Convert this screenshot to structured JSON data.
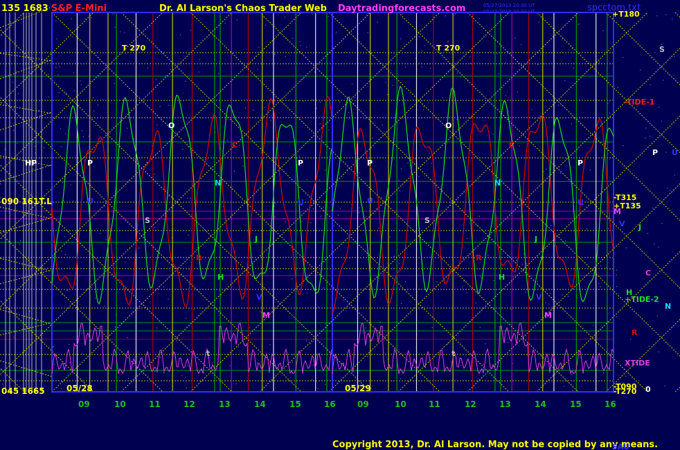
{
  "header": {
    "left_price": "135  1683",
    "symbol": "S&P E-Mini",
    "title": "Dr. Al Larson's Chaos Trader Web",
    "site": "Daytradingforecasts.com",
    "stamp_1": "05/27/2013 20:30 UT",
    "stamp_2": "05/27/2013 20:30 UT",
    "filename": "spcctom.txt",
    "top_level": "+T180"
  },
  "footer": {
    "copyright": "Copyright 2013, Dr. Al Larson. May not be copied by any means.",
    "bottom_right": "SAU"
  },
  "colors": {
    "background": "#000050",
    "grid_yellow": "#d8d800",
    "grid_green": "#00b000",
    "grid_red": "#c00000",
    "grid_magenta": "#c000c0",
    "frame_blue": "#3030ff",
    "trace_red": "#e00000",
    "trace_green": "#20e020",
    "trace_xtide": "#e040e0"
  },
  "left_scale": {
    "top": "135  1683",
    "mid": "090  161T.L",
    "bottom": "045  1665"
  },
  "chart_data": {
    "type": "line",
    "title": "S&P E-Mini",
    "x_dates_panel_1": "05/28",
    "x_dates_panel_2": "05/29",
    "x_tick_labels": [
      "09",
      "10",
      "11",
      "12",
      "13",
      "14",
      "15",
      "16",
      "09",
      "10",
      "11",
      "12",
      "13",
      "14",
      "15",
      "16"
    ],
    "price_labels": {
      "top": "1683",
      "middle": "161T.L",
      "bottom": "1665"
    },
    "series": [
      {
        "name": "-TIDE-1",
        "color": "#e00000"
      },
      {
        "name": "+TIDE-2",
        "color": "#20e020"
      },
      {
        "name": "XTIDE",
        "color": "#e040e0"
      }
    ],
    "right_labels": [
      {
        "text": "+T180",
        "color": "#ffff00"
      },
      {
        "text": "S",
        "color": "#c0c0c0"
      },
      {
        "text": "-TIDE-1",
        "color": "#ff2020"
      },
      {
        "text": "P",
        "color": "#ffffff"
      },
      {
        "text": "U",
        "color": "#3030ff"
      },
      {
        "text": "-T315",
        "color": "#ffff00"
      },
      {
        "text": "+T135",
        "color": "#ffff00"
      },
      {
        "text": "M",
        "color": "#ff40ff"
      },
      {
        "text": "V",
        "color": "#3030ff"
      },
      {
        "text": "J",
        "color": "#20e020"
      },
      {
        "text": "C",
        "color": "#e040e0"
      },
      {
        "text": "H",
        "color": "#20e020"
      },
      {
        "text": "+TIDE-2",
        "color": "#20e020"
      },
      {
        "text": "N",
        "color": "#00e0ff"
      },
      {
        "text": "R",
        "color": "#e00000"
      },
      {
        "text": "XTIDE",
        "color": "#e040e0"
      },
      {
        "text": "-T090",
        "color": "#ffff00"
      },
      {
        "text": "-T270",
        "color": "#ffff00"
      },
      {
        "text": "0",
        "color": "#ffffff"
      }
    ],
    "markers_panel_1": [
      {
        "text": "T  270",
        "color": "#ffff00"
      },
      {
        "text": "O",
        "color": "#ffffff"
      },
      {
        "text": "P",
        "color": "#ffffff"
      },
      {
        "text": "P",
        "color": "#ffffff"
      },
      {
        "text": "C",
        "color": "#e00000"
      },
      {
        "text": "N",
        "color": "#00e0ff"
      },
      {
        "text": "U",
        "color": "#3030ff"
      },
      {
        "text": "S",
        "color": "#c0c0c0"
      },
      {
        "text": "U",
        "color": "#3030ff"
      },
      {
        "text": "J",
        "color": "#20e020"
      },
      {
        "text": "R",
        "color": "#e00000"
      },
      {
        "text": "H",
        "color": "#20e020"
      },
      {
        "text": "V",
        "color": "#3030ff"
      },
      {
        "text": "M",
        "color": "#ff40ff"
      },
      {
        "text": "t",
        "color": "#c0c0c0"
      }
    ],
    "markers_panel_2": [
      {
        "text": "T  270",
        "color": "#ffff00"
      },
      {
        "text": "O",
        "color": "#ffffff"
      },
      {
        "text": "P",
        "color": "#ffffff"
      },
      {
        "text": "P",
        "color": "#ffffff"
      },
      {
        "text": "C",
        "color": "#e00000"
      },
      {
        "text": "N",
        "color": "#00e0ff"
      },
      {
        "text": "U",
        "color": "#3030ff"
      },
      {
        "text": "S",
        "color": "#c0c0c0"
      },
      {
        "text": "U",
        "color": "#3030ff"
      },
      {
        "text": "J",
        "color": "#20e020"
      },
      {
        "text": "R",
        "color": "#e00000"
      },
      {
        "text": "H",
        "color": "#20e020"
      },
      {
        "text": "V",
        "color": "#3030ff"
      },
      {
        "text": "M",
        "color": "#ff40ff"
      },
      {
        "text": "t",
        "color": "#c0c0c0"
      }
    ]
  }
}
